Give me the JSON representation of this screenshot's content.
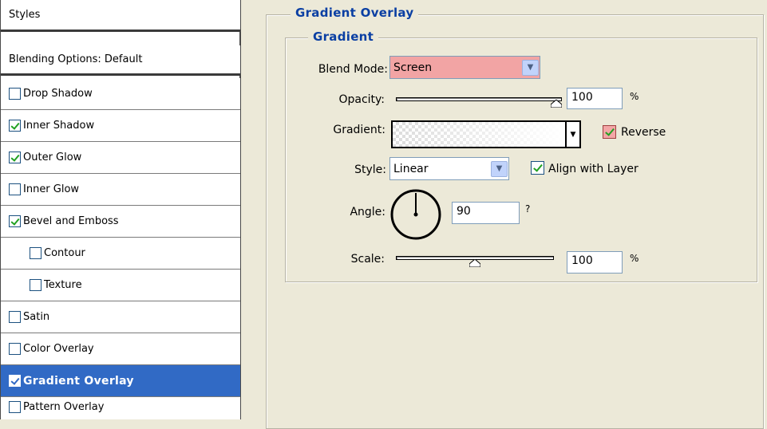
{
  "sidebar": {
    "title": "Styles",
    "blending": "Blending Options: Default",
    "items": [
      {
        "label": "Drop Shadow",
        "checked": false
      },
      {
        "label": "Inner Shadow",
        "checked": true
      },
      {
        "label": "Outer Glow",
        "checked": true
      },
      {
        "label": "Inner Glow",
        "checked": false
      },
      {
        "label": "Bevel and Emboss",
        "checked": true
      },
      {
        "label": "Contour",
        "checked": false
      },
      {
        "label": "Texture",
        "checked": false
      },
      {
        "label": "Satin",
        "checked": false
      },
      {
        "label": "Color Overlay",
        "checked": false
      },
      {
        "label": "Gradient Overlay",
        "checked": true
      },
      {
        "label": "Pattern Overlay",
        "checked": false
      }
    ]
  },
  "panel": {
    "section_title": "Gradient Overlay",
    "group_title": "Gradient",
    "blend_mode": {
      "label": "Blend Mode:",
      "value": "Screen",
      "color": "#f2a4a4"
    },
    "opacity": {
      "label": "Opacity:",
      "value": "100",
      "unit": "%",
      "level": 1.0
    },
    "gradient": {
      "label": "Gradient:",
      "reverse_label": "Reverse",
      "reverse_checked": true
    },
    "style": {
      "label": "Style:",
      "value": "Linear",
      "align_label": "Align with Layer",
      "align_checked": true
    },
    "angle": {
      "label": "Angle:",
      "value": "90",
      "unit": "?",
      "degrees": 90
    },
    "scale": {
      "label": "Scale:",
      "value": "100",
      "unit": "%",
      "level": 0.5
    }
  },
  "colors": {
    "selection": "#316ac5",
    "legend": "#0a3fa3",
    "panel_bg": "#ece9d8"
  }
}
